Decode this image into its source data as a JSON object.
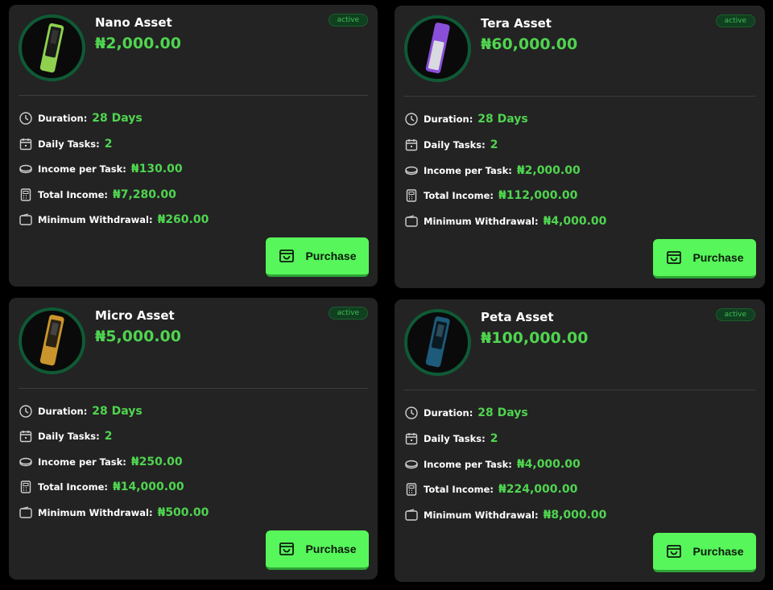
{
  "colors": {
    "background": "#000000",
    "card": "#232323",
    "accent_green": "#4fd44f",
    "button_green": "#57f65a",
    "ring": "#0f5a35"
  },
  "icons": {
    "duration": "clock-icon",
    "daily_tasks": "calendar-icon",
    "income_per_task": "coin-icon",
    "total_income": "calculator-icon",
    "minimum_withdrawal": "wallet-icon",
    "purchase": "shopping-bag-icon"
  },
  "labels": {
    "duration": "Duration:",
    "daily_tasks": "Daily Tasks:",
    "income_per_task": "Income per Task:",
    "total_income": "Total Income:",
    "minimum_withdrawal": "Minimum Withdrawal:",
    "purchase": "Purchase"
  },
  "plans": [
    {
      "name": "Nano Asset",
      "price": "₦2,000.00",
      "status": "active",
      "device_color": "#8fd14f",
      "duration": "28 Days",
      "daily_tasks": "2",
      "income_per_task": "₦130.00",
      "total_income": "₦7,280.00",
      "minimum_withdrawal": "₦260.00"
    },
    {
      "name": "Tera Asset",
      "price": "₦60,000.00",
      "status": "active",
      "device_color": "#8a4fd8",
      "duration": "28 Days",
      "daily_tasks": "2",
      "income_per_task": "₦2,000.00",
      "total_income": "₦112,000.00",
      "minimum_withdrawal": "₦4,000.00"
    },
    {
      "name": "Micro Asset",
      "price": "₦5,000.00",
      "status": "active",
      "device_color": "#c9952c",
      "duration": "28 Days",
      "daily_tasks": "2",
      "income_per_task": "₦250.00",
      "total_income": "₦14,000.00",
      "minimum_withdrawal": "₦500.00"
    },
    {
      "name": "Peta Asset",
      "price": "₦100,000.00",
      "status": "active",
      "device_color": "#1e5a7a",
      "duration": "28 Days",
      "daily_tasks": "2",
      "income_per_task": "₦4,000.00",
      "total_income": "₦224,000.00",
      "minimum_withdrawal": "₦8,000.00"
    }
  ]
}
